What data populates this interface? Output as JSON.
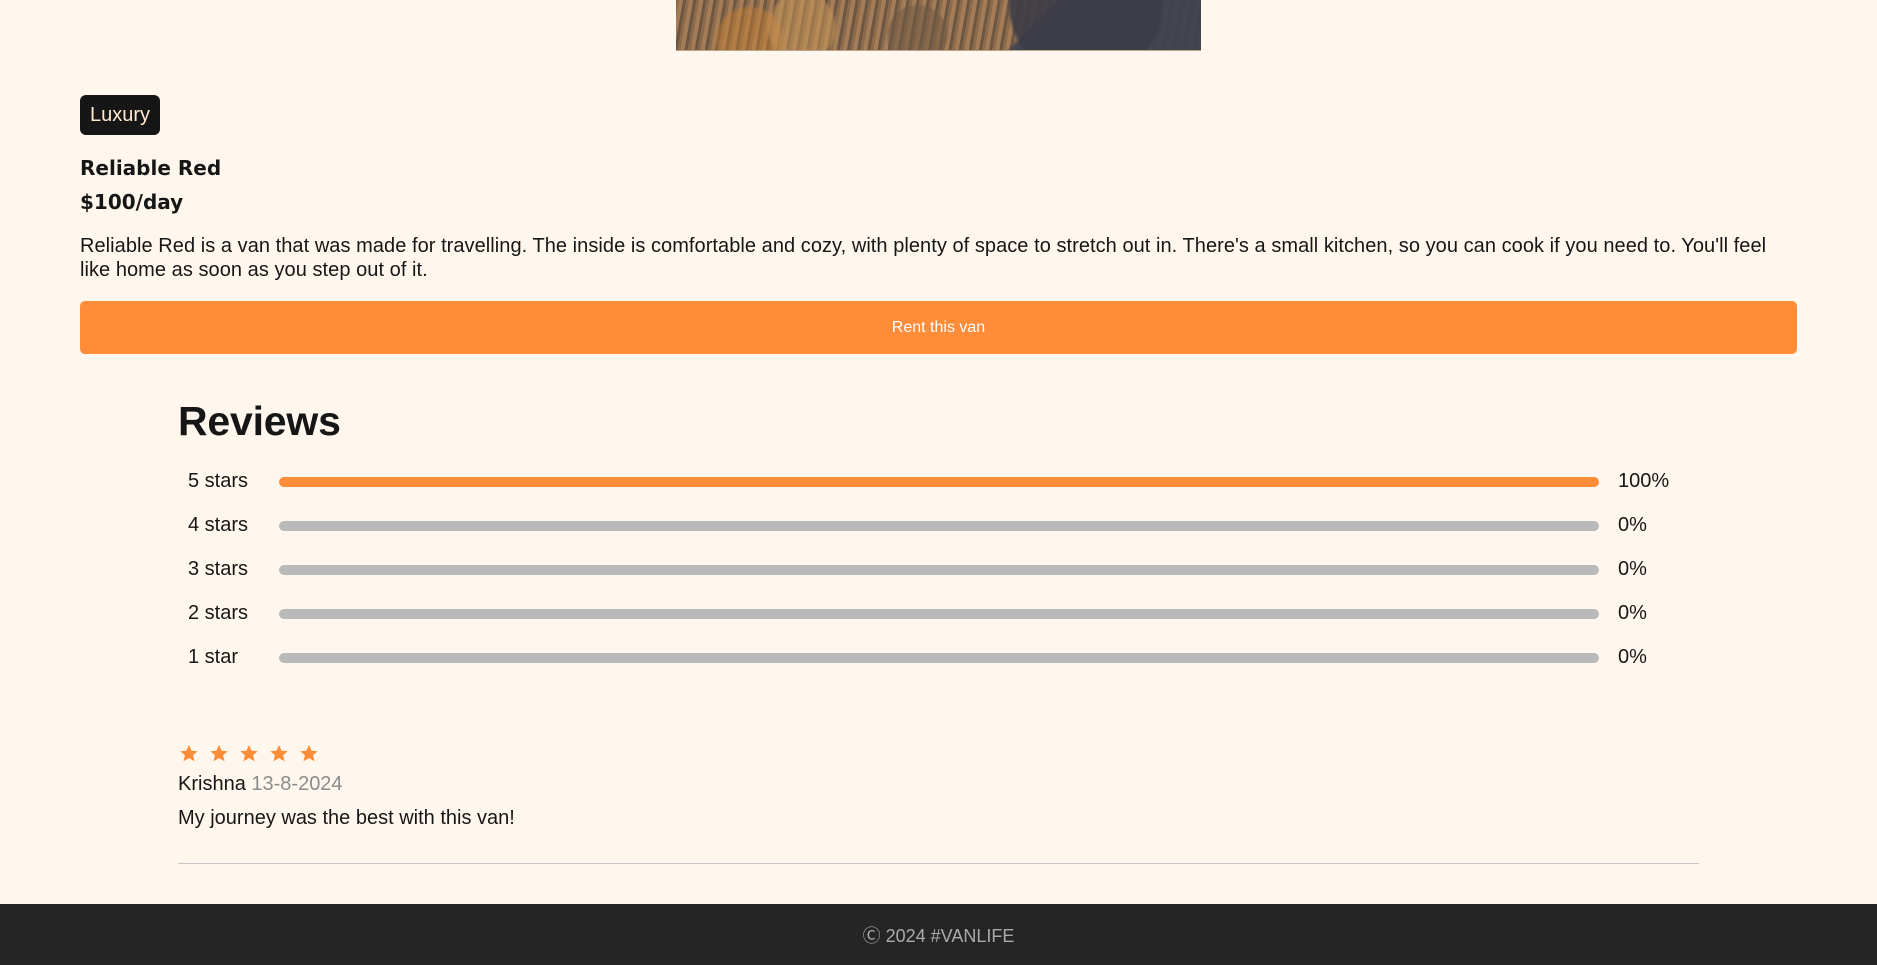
{
  "van": {
    "image_alt": "Reliable Red van",
    "type": "Luxury",
    "name": "Reliable Red",
    "price": "$100/day",
    "description": "Reliable Red is a van that was made for travelling. The inside is comfortable and cozy, with plenty of space to stretch out in. There's a small kitchen, so you can cook if you need to. You'll feel like home as soon as you step out of it.",
    "rent_label": "Rent this van"
  },
  "reviews": {
    "title": "Reviews",
    "ratings": [
      {
        "label": "5 stars",
        "percent": "100%",
        "fill_percent": 100
      },
      {
        "label": "4 stars",
        "percent": "0%",
        "fill_percent": 0
      },
      {
        "label": "3 stars",
        "percent": "0%",
        "fill_percent": 0
      },
      {
        "label": "2 stars",
        "percent": "0%",
        "fill_percent": 0
      },
      {
        "label": "1 star",
        "percent": "0%",
        "fill_percent": 0
      }
    ],
    "items": [
      {
        "stars": 5,
        "reviewer": "Krishna",
        "date": "13-8-2024",
        "text": "My journey was the best with this van!"
      }
    ]
  },
  "footer": {
    "text": "Ⓒ 2024 #VANLIFE"
  },
  "colors": {
    "background": "#FFF7ED",
    "accent": "#FF8C38",
    "badge_background": "#161616",
    "badge_text": "#FFEAD0",
    "inactive_track": "#B9B9B9",
    "footer_background": "#252525"
  },
  "icons": {
    "review_star": "star-icon"
  }
}
